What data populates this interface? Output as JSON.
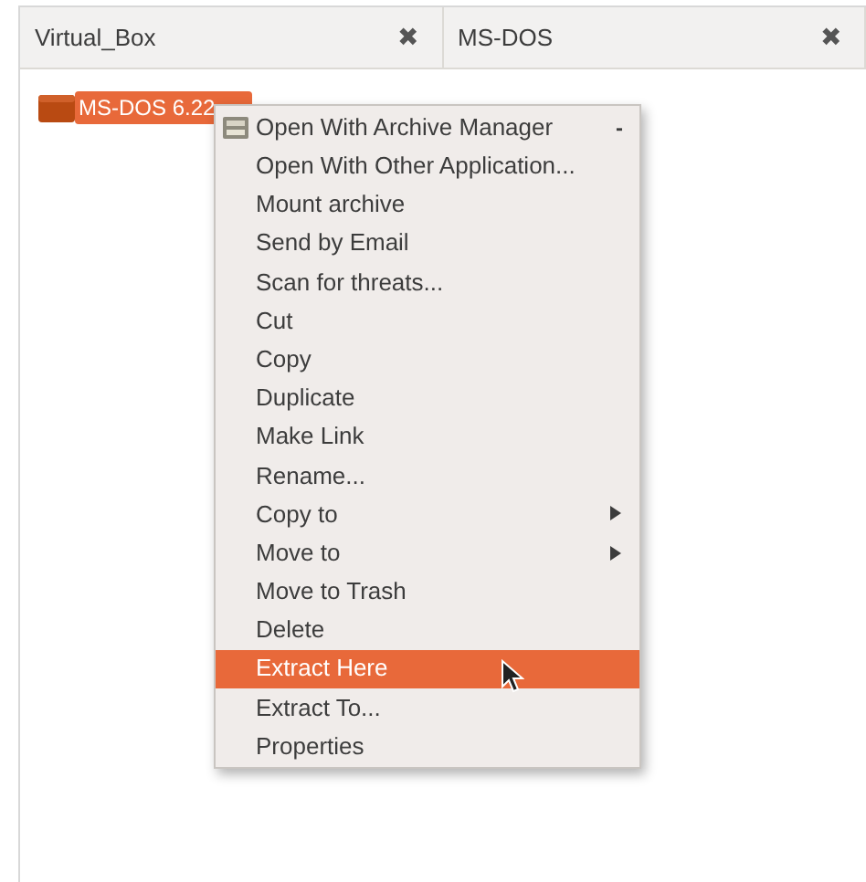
{
  "tabs": [
    {
      "label": "Virtual_Box",
      "close": "✖"
    },
    {
      "label": "MS-DOS",
      "close": "✖"
    }
  ],
  "file": {
    "name": "MS-DOS 6.22",
    "selected": true
  },
  "context_menu": {
    "items": [
      {
        "label": "Open With Archive Manager",
        "icon": true,
        "trailing": "-",
        "submenu": false,
        "selected": false
      },
      {
        "label": "Open With Other Application...",
        "submenu": false,
        "selected": false
      },
      {
        "label": "Mount archive",
        "submenu": false,
        "selected": false
      },
      {
        "label": "Send by Email",
        "submenu": false,
        "selected": false
      },
      {
        "label": "Scan for threats...",
        "submenu": false,
        "selected": false
      },
      {
        "label": "Cut",
        "submenu": false,
        "selected": false
      },
      {
        "label": "Copy",
        "submenu": false,
        "selected": false
      },
      {
        "label": "Duplicate",
        "submenu": false,
        "selected": false
      },
      {
        "label": "Make Link",
        "submenu": false,
        "selected": false
      },
      {
        "label": "Rename...",
        "submenu": false,
        "selected": false
      },
      {
        "label": "Copy to",
        "submenu": true,
        "selected": false
      },
      {
        "label": "Move to",
        "submenu": true,
        "selected": false
      },
      {
        "label": "Move to Trash",
        "submenu": false,
        "selected": false
      },
      {
        "label": "Delete",
        "submenu": false,
        "selected": false
      },
      {
        "label": "Extract Here",
        "submenu": false,
        "selected": true
      },
      {
        "label": "Extract To...",
        "submenu": false,
        "selected": false
      },
      {
        "label": "Properties",
        "submenu": false,
        "selected": false
      }
    ]
  }
}
